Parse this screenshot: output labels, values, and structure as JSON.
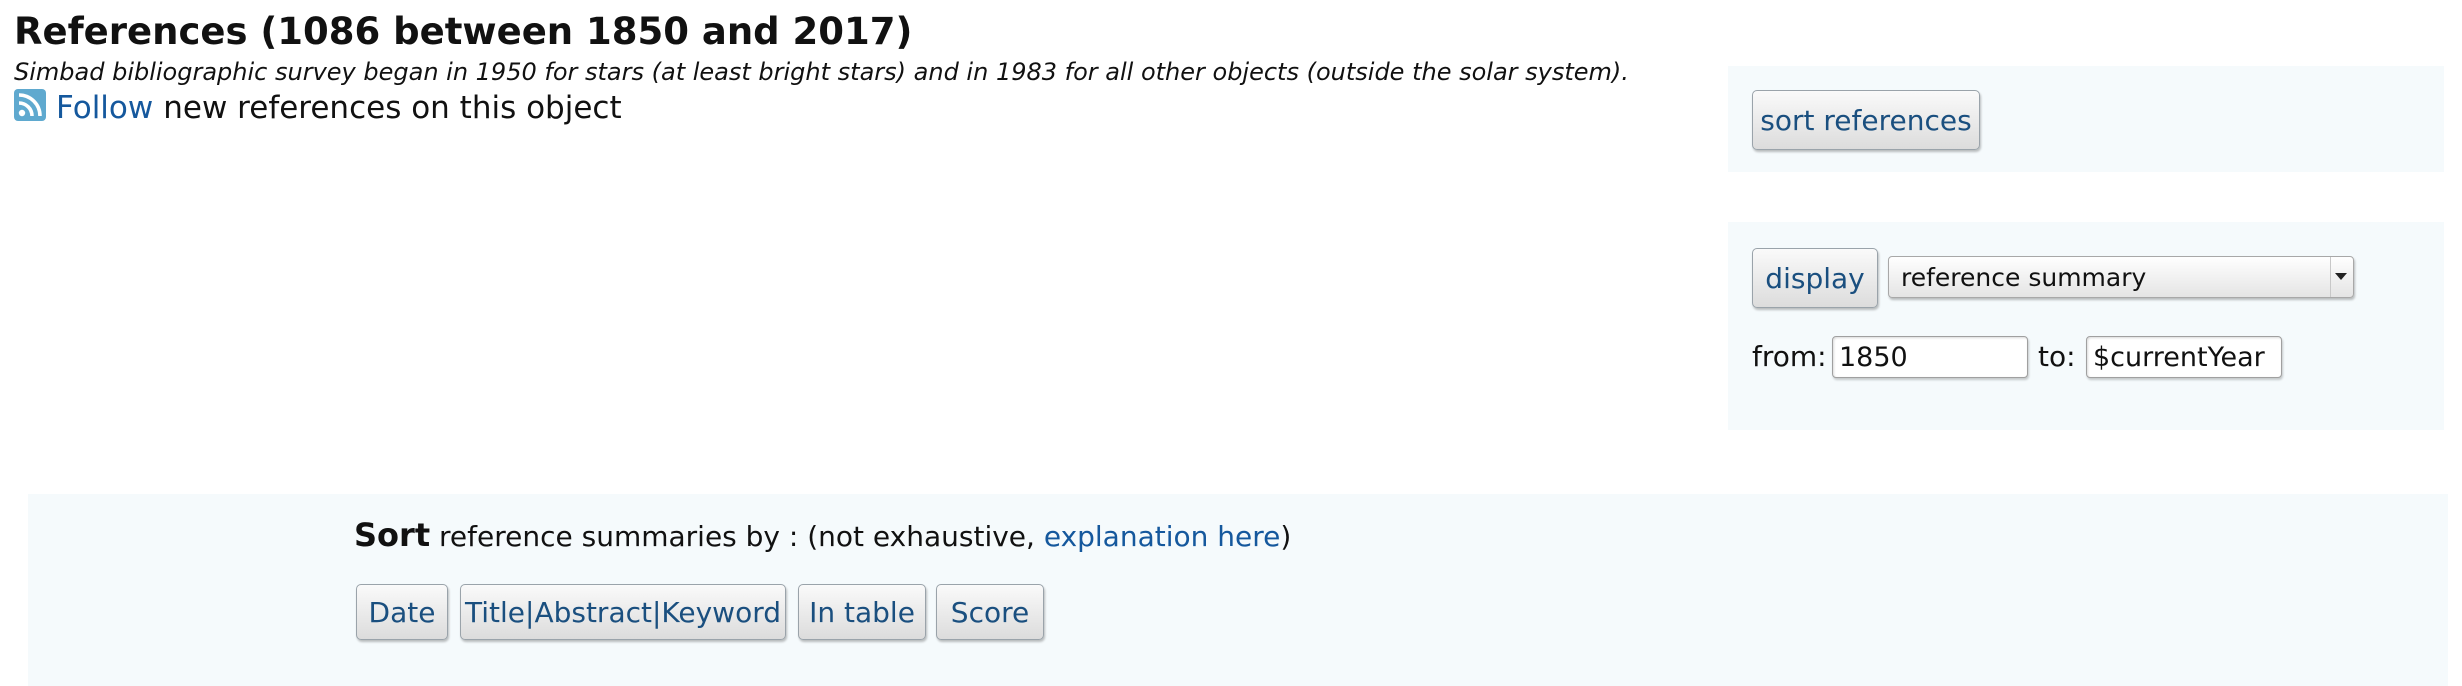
{
  "header": {
    "title": "References (1086 between 1850 and 2017)",
    "survey_note": "Simbad bibliographic survey began in 1950 for stars (at least bright stars) and in 1983 for all other objects (outside the solar system).",
    "follow_link": "Follow",
    "follow_rest": "new references on this object"
  },
  "sort_panel": {
    "button_label": "sort references"
  },
  "display_panel": {
    "button_label": "display",
    "select_value": "reference summary",
    "from_label": "from:",
    "from_value": "1850",
    "to_label": "to:",
    "to_value": "$currentYear"
  },
  "bottom_panel": {
    "sort_word": "Sort",
    "sort_text_before": "reference summaries by : (not exhaustive,",
    "explanation_link": "explanation here",
    "sort_text_after": ")",
    "buttons": [
      {
        "label": "Date"
      },
      {
        "label": "Title|Abstract|Keyword"
      },
      {
        "label": "In table"
      },
      {
        "label": "Score"
      }
    ]
  },
  "colors": {
    "link": "#15589d",
    "panel_bg": "#f5fafc",
    "button_text": "#1a4f7f",
    "rss_orange": "#5fa9cf"
  },
  "icons": {
    "rss": "rss-feed-icon"
  }
}
